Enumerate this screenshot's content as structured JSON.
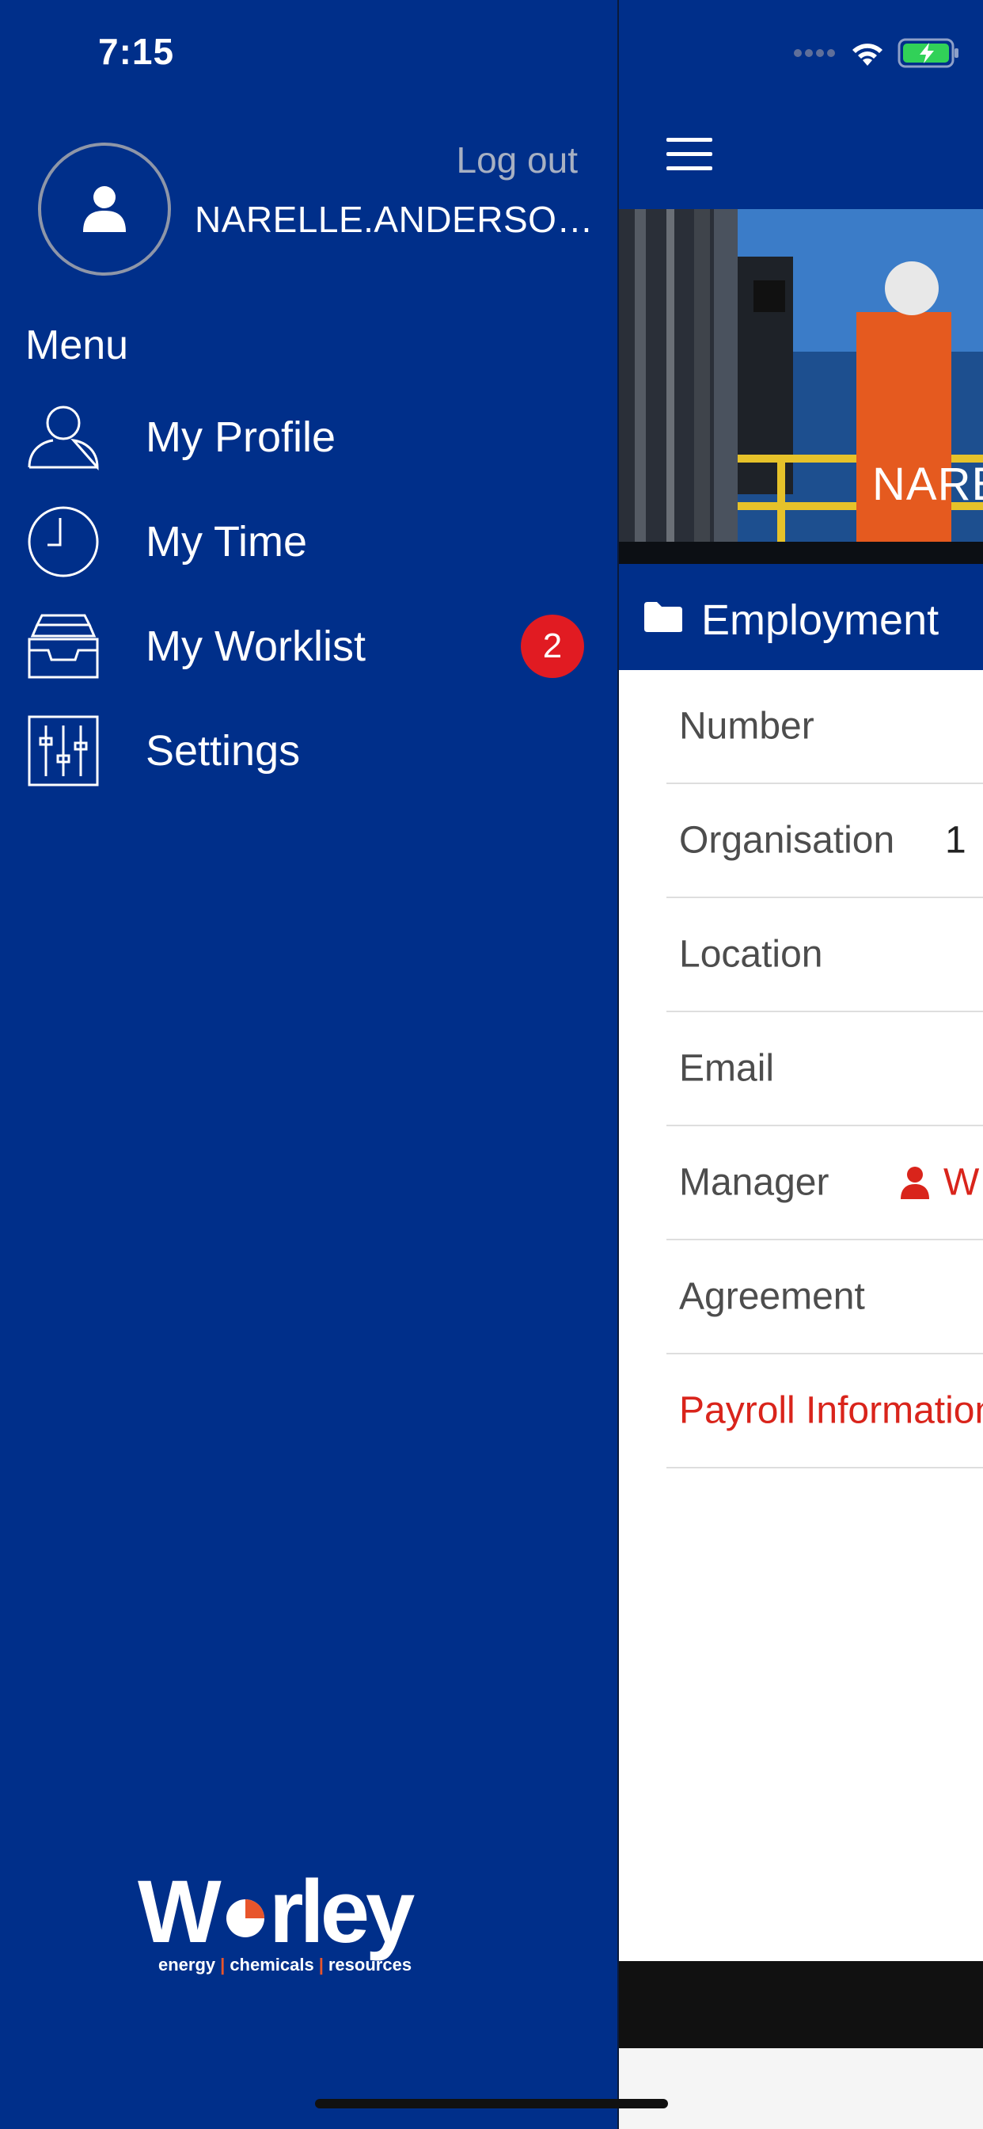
{
  "status_bar": {
    "time": "7:15"
  },
  "profile": {
    "logout_label": "Log out",
    "username": "NARELLE.ANDERSON..."
  },
  "menu": {
    "heading": "Menu",
    "items": [
      {
        "label": "My Profile",
        "icon": "person-outline-icon"
      },
      {
        "label": "My Time",
        "icon": "clock-icon"
      },
      {
        "label": "My Worklist",
        "icon": "inbox-tray-icon",
        "badge": "2"
      },
      {
        "label": "Settings",
        "icon": "sliders-icon"
      }
    ]
  },
  "logo": {
    "wordmark": "Worley",
    "tagline": [
      "energy",
      "chemicals",
      "resources"
    ]
  },
  "main": {
    "hero_name": "NARE",
    "section_title": "Employment",
    "rows": [
      {
        "label": "Number",
        "value": ""
      },
      {
        "label": "Organisation",
        "value": "1"
      },
      {
        "label": "Location",
        "value": ""
      },
      {
        "label": "Email",
        "value": ""
      },
      {
        "label": "Manager",
        "value": "W"
      },
      {
        "label": "Agreement",
        "value": ""
      },
      {
        "label": "Payroll Information",
        "value": ""
      }
    ]
  },
  "colors": {
    "brand_blue": "#002f8a",
    "badge_red": "#e11b22",
    "link_red": "#d9241b",
    "logo_orange": "#e8552b"
  }
}
